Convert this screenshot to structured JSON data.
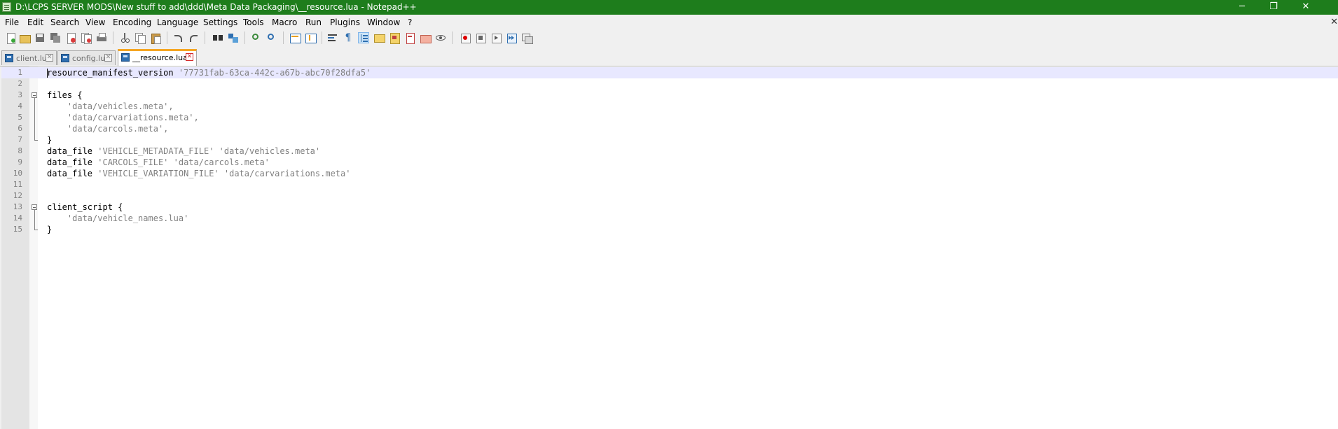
{
  "window": {
    "title": "D:\\LCPS SERVER MODS\\New stuff to add\\ddd\\Meta Data Packaging\\__resource.lua - Notepad++",
    "minimize": "─",
    "restore": "❐",
    "close": "✕"
  },
  "menu": {
    "items": [
      "File",
      "Edit",
      "Search",
      "View",
      "Encoding",
      "Language",
      "Settings",
      "Tools",
      "Macro",
      "Run",
      "Plugins",
      "Window",
      "?"
    ],
    "close": "✕"
  },
  "tabs": [
    {
      "label": "client.lua",
      "active": false,
      "close": "✕"
    },
    {
      "label": "config.lua",
      "active": false,
      "close": "✕"
    },
    {
      "label": "__resource.lua",
      "active": true,
      "close": "✕"
    }
  ],
  "editor": {
    "lines": [
      {
        "n": "1",
        "text": "resource_manifest_version ",
        "str": "'77731fab-63ca-442c-a67b-abc70f28dfa5'"
      },
      {
        "n": "2",
        "text": "",
        "str": ""
      },
      {
        "n": "3",
        "text": "files {",
        "str": ""
      },
      {
        "n": "4",
        "text": "    ",
        "str": "'data/vehicles.meta',"
      },
      {
        "n": "5",
        "text": "    ",
        "str": "'data/carvariations.meta',"
      },
      {
        "n": "6",
        "text": "    ",
        "str": "'data/carcols.meta',"
      },
      {
        "n": "7",
        "text": "}",
        "str": ""
      },
      {
        "n": "8",
        "text": "data_file ",
        "str": "'VEHICLE_METADATA_FILE' 'data/vehicles.meta'"
      },
      {
        "n": "9",
        "text": "data_file ",
        "str": "'CARCOLS_FILE' 'data/carcols.meta'"
      },
      {
        "n": "10",
        "text": "data_file ",
        "str": "'VEHICLE_VARIATION_FILE' 'data/carvariations.meta'"
      },
      {
        "n": "11",
        "text": "",
        "str": ""
      },
      {
        "n": "12",
        "text": "",
        "str": ""
      },
      {
        "n": "13",
        "text": "client_script {",
        "str": ""
      },
      {
        "n": "14",
        "text": "    ",
        "str": "'data/vehicle_names.lua'"
      },
      {
        "n": "15",
        "text": "}",
        "str": ""
      }
    ]
  },
  "colors": {
    "titlebar": "#1e7d1c",
    "active_tab_accent": "#f5a623",
    "current_line": "#e8e8ff",
    "string": "#808080"
  },
  "toolbar": {
    "icons": [
      "new-file-icon",
      "open-file-icon",
      "save-icon",
      "save-all-icon",
      "close-icon",
      "close-all-icon",
      "print-icon",
      "cut-icon",
      "copy-icon",
      "paste-icon",
      "undo-icon",
      "redo-icon",
      "find-icon",
      "replace-icon",
      "zoom-in-icon",
      "zoom-out-icon",
      "sync-vertical-icon",
      "sync-horizontal-icon",
      "word-wrap-icon",
      "show-all-chars-icon",
      "indent-guide-icon",
      "user-language-icon",
      "doc-map-icon",
      "function-list-icon",
      "folder-workspace-icon",
      "monitoring-icon",
      "record-macro-icon",
      "stop-macro-icon",
      "play-macro-icon",
      "run-macro-multiple-icon",
      "save-macro-icon"
    ]
  }
}
